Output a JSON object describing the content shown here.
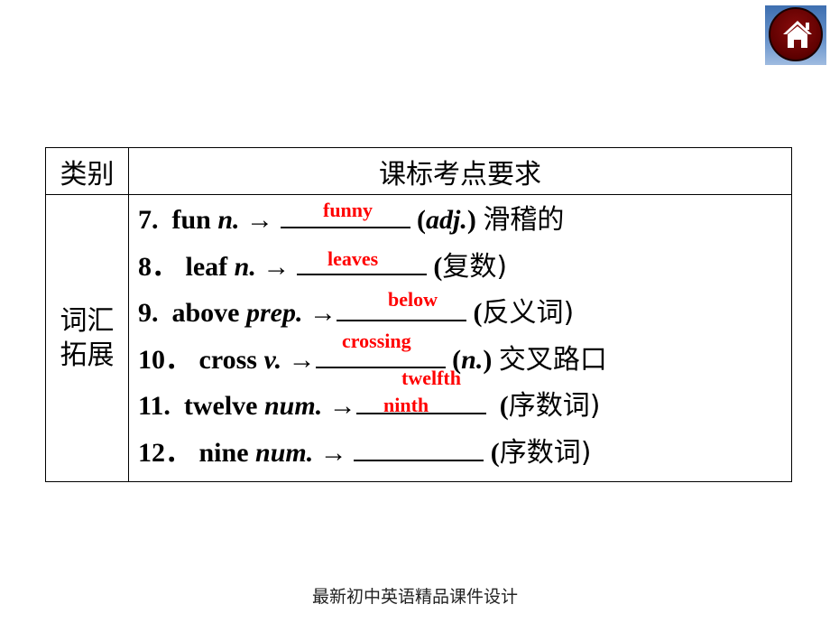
{
  "home_button": {
    "icon": "home-icon"
  },
  "table": {
    "headers": {
      "category": "类别",
      "requirement": "课标考点要求"
    },
    "category_label_line1": "词汇",
    "category_label_line2": "拓展",
    "items": [
      {
        "num": "7.",
        "word": "fun",
        "pos": "n.",
        "arrow": "→",
        "answer": "funny",
        "note_pre": "(",
        "note_pos": "adj.",
        "note_post": ")",
        "note_cn": "滑稽的"
      },
      {
        "num": "8．",
        "word": "leaf",
        "pos": "n.",
        "arrow": "→",
        "answer": "leaves",
        "note_pre": "(",
        "note_pos": "",
        "note_post": "",
        "note_cn": "复数)"
      },
      {
        "num": "9.",
        "word": "above",
        "pos": "prep.",
        "arrow": "→",
        "answer": "below",
        "note_pre": "(",
        "note_pos": "",
        "note_post": "",
        "note_cn": "反义词)"
      },
      {
        "num": "10．",
        "word": "cross",
        "pos": "v.",
        "arrow": "→",
        "answer": "crossing",
        "note_pre": "(",
        "note_pos": "n.",
        "note_post": ")",
        "note_cn": "交叉路口"
      },
      {
        "num": "11.",
        "word": "twelve",
        "pos": "num.",
        "arrow": "→",
        "answer": "twelfth",
        "note_pre": "(",
        "note_pos": "",
        "note_post": "",
        "note_cn": "序数词)"
      },
      {
        "num": "12．",
        "word": "nine",
        "pos": "num.",
        "arrow": "→",
        "answer": "ninth",
        "note_pre": "(",
        "note_pos": "",
        "note_post": "",
        "note_cn": "序数词)"
      }
    ]
  },
  "footer": {
    "text": "最新初中英语精品课件设计"
  },
  "colors": {
    "answer": "#ff0000",
    "home_bg": "#5e0000"
  }
}
